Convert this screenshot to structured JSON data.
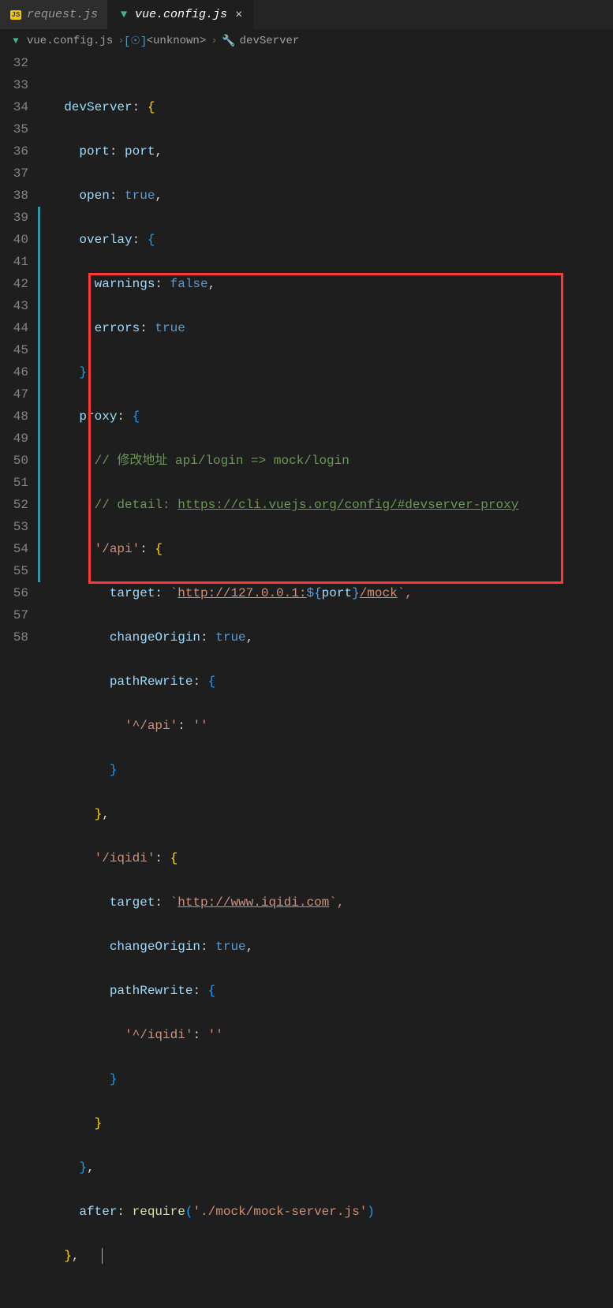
{
  "tabs": [
    {
      "label": "request.js",
      "iconColor": "#f1c40f",
      "active": false
    },
    {
      "label": "vue.config.js",
      "iconColor": "#41b883",
      "active": true
    }
  ],
  "breadcrumb": {
    "file": "vue.config.js",
    "segment2": "<unknown>",
    "segment3": "devServer"
  },
  "gutter": {
    "start": 32,
    "end": 58
  },
  "code": {
    "l32": {
      "prop": "devServer",
      "brace": "{"
    },
    "l33": {
      "prop": "port",
      "val": "port"
    },
    "l34": {
      "prop": "open",
      "val": "true"
    },
    "l35": {
      "prop": "overlay",
      "brace": "{"
    },
    "l36": {
      "prop": "warnings",
      "val": "false"
    },
    "l37": {
      "prop": "errors",
      "val": "true"
    },
    "l38": {
      "brace": "},"
    },
    "l39": {
      "prop": "proxy",
      "brace": "{"
    },
    "l40": {
      "comment": "// 修改地址 api/login => mock/login"
    },
    "l41": {
      "comment_pre": "// detail: ",
      "link": "https://cli.vuejs.org/config/#devserver-proxy"
    },
    "l42": {
      "key": "'/api'",
      "brace": "{"
    },
    "l43": {
      "prop": "target",
      "tpl_pre": "`",
      "tpl_url": "http://127.0.0.1:",
      "tpl_var": "port",
      "tpl_post": "/mock",
      "tpl_suf": "`,"
    },
    "l44": {
      "prop": "changeOrigin",
      "val": "true"
    },
    "l45": {
      "prop": "pathRewrite",
      "brace": "{"
    },
    "l46": {
      "key": "'^/api'",
      "val": "''"
    },
    "l47": {
      "brace": "}"
    },
    "l48": {
      "brace": "},"
    },
    "l49": {
      "key": "'/iqidi'",
      "brace": "{"
    },
    "l50": {
      "prop": "target",
      "tpl_pre": "`",
      "tpl_url": "http://www.iqidi.com",
      "tpl_suf": "`,"
    },
    "l51": {
      "prop": "changeOrigin",
      "val": "true"
    },
    "l52": {
      "prop": "pathRewrite",
      "brace": "{"
    },
    "l53": {
      "key": "'^/iqidi'",
      "val": "''"
    },
    "l54": {
      "brace": "}"
    },
    "l55": {
      "brace": "}"
    },
    "l56": {
      "brace": "},"
    },
    "l57": {
      "prop": "after",
      "call": "require",
      "arg": "'./mock/mock-server.js'"
    },
    "l58": {
      "brace": "},"
    }
  },
  "redbox": {
    "top_line": 42,
    "bottom_line": 55
  },
  "colors": {
    "bg": "#1e1e1e",
    "tabbar": "#252526",
    "gutter": "#858585",
    "property": "#9cdcfe",
    "bool": "#569cd6",
    "comment": "#6a9955",
    "string": "#ce9178",
    "func": "#dcdcaa",
    "redbox": "#ff3838"
  }
}
